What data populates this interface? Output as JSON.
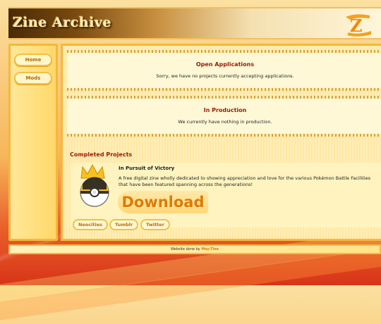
{
  "header": {
    "site_title": "Zine Archive",
    "logo_text": "Z"
  },
  "nav": {
    "items": [
      {
        "label": "Home"
      },
      {
        "label": "Mods"
      }
    ]
  },
  "open_applications": {
    "title": "Open Applications",
    "text": "Sorry, we have no projects currently accepting applications."
  },
  "in_production": {
    "title": "In Production",
    "text": "We currently have nothing in production."
  },
  "completed": {
    "title": "Completed Projects",
    "project": {
      "title": "In Pursuit of Victory",
      "description": "A free digital zine wholly dedicated to showing appreciation and love for the various Pokémon Battle Facilities that have been featured spanning across the generations!",
      "download_label": "Download",
      "links": [
        "Neocities",
        "Tumblr",
        "Twitter"
      ]
    }
  },
  "footer": {
    "prefix": "Website done by",
    "credit": "May-Tiee"
  },
  "colors": {
    "accent": "#9a1a00",
    "button_text": "#e07a00",
    "border": "#f5b83a"
  }
}
